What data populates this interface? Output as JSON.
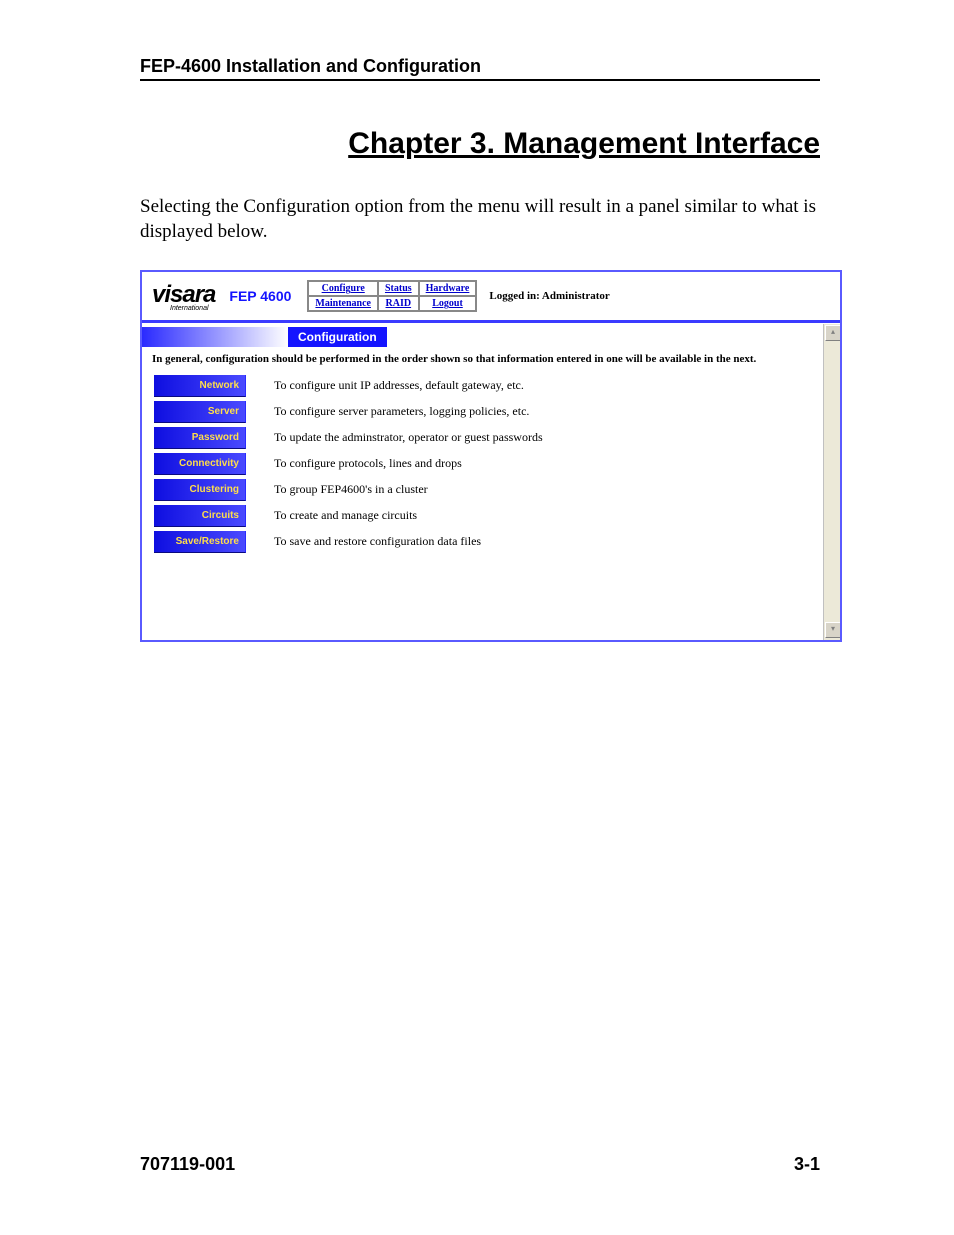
{
  "document": {
    "running_head": "FEP-4600 Installation and Configuration",
    "chapter_title": "Chapter 3. Management Interface",
    "intro_text": "Selecting the Configuration option from the menu will result in a panel similar to what is displayed below.",
    "footer_doc_number": "707119-001",
    "footer_page_number": "3-1"
  },
  "screenshot": {
    "logo_text": "visara",
    "logo_sub": "International",
    "product_label": "FEP 4600",
    "nav": {
      "r1c1": "Configure",
      "r1c2": "Status",
      "r1c3": "Hardware",
      "r2c1": "Maintenance",
      "r2c2": "RAID",
      "r2c3": "Logout"
    },
    "logged_in_label": "Logged in: Administrator",
    "section_title": "Configuration",
    "section_intro": "In general, configuration should be performed in the order shown so that information entered in one will be available in the next.",
    "menu": [
      {
        "label": "Network",
        "desc": "To configure unit IP addresses, default gateway, etc."
      },
      {
        "label": "Server",
        "desc": "To configure server parameters, logging policies, etc."
      },
      {
        "label": "Password",
        "desc": "To update the adminstrator, operator or guest passwords"
      },
      {
        "label": "Connectivity",
        "desc": "To configure protocols, lines and drops"
      },
      {
        "label": "Clustering",
        "desc": "To group FEP4600's in a cluster"
      },
      {
        "label": "Circuits",
        "desc": "To create and manage circuits"
      },
      {
        "label": "Save/Restore",
        "desc": "To save and restore configuration data files"
      }
    ]
  }
}
